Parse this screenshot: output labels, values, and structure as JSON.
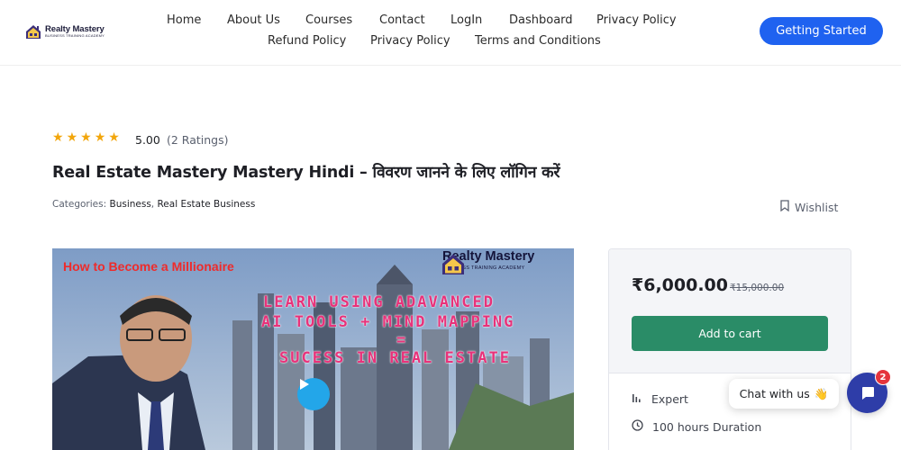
{
  "header": {
    "logo": {
      "title": "Realty Mastery",
      "subtitle": "BUSINESS TRAINING ACADEMY"
    },
    "nav": [
      {
        "label": "Home"
      },
      {
        "label": "About Us"
      },
      {
        "label": "Courses"
      },
      {
        "label": "Contact"
      },
      {
        "label": "LogIn"
      },
      {
        "label": "Dashboard"
      },
      {
        "label": "Privacy Policy"
      },
      {
        "label": "Refund Policy"
      },
      {
        "label": "Privacy Policy"
      },
      {
        "label": "Terms and Conditions"
      }
    ],
    "cta_label": "Getting Started"
  },
  "course": {
    "rating": {
      "stars": 5,
      "value": "5.00",
      "count_text": "(2 Ratings)"
    },
    "title": "Real Estate Mastery Mastery Hindi – विवरण जानने के लिए लॉगिन करें",
    "categories_label": "Categories:",
    "categories": [
      "Business",
      "Real Estate Business"
    ],
    "wishlist_label": "Wishlist"
  },
  "video": {
    "headline": "How to Become a Millionaire",
    "brand_title": "Realty Mastery",
    "brand_subtitle": "BUSINESS TRAINING ACADEMY",
    "lines": [
      "LEARN USING ADAVANCED",
      "AI TOOLS + MIND MAPPING",
      "=",
      "SUCESS IN REAL ESTATE"
    ]
  },
  "pricing": {
    "price": "₹6,000.00",
    "old_price": "₹15,000.00",
    "add_to_cart_label": "Add to cart",
    "meta": [
      {
        "icon": "level-bars-icon",
        "text": "Expert"
      },
      {
        "icon": "clock-icon",
        "text": "100 hours  Duration"
      }
    ]
  },
  "chat": {
    "label": "Chat with us",
    "emoji": "👋",
    "badge": "2"
  },
  "colors": {
    "primary_blue": "#1f62f0",
    "cart_green": "#2a8c67",
    "star_gold": "#f2a60c",
    "chat_navy": "#2e3da8",
    "badge_red": "#e5343c"
  }
}
